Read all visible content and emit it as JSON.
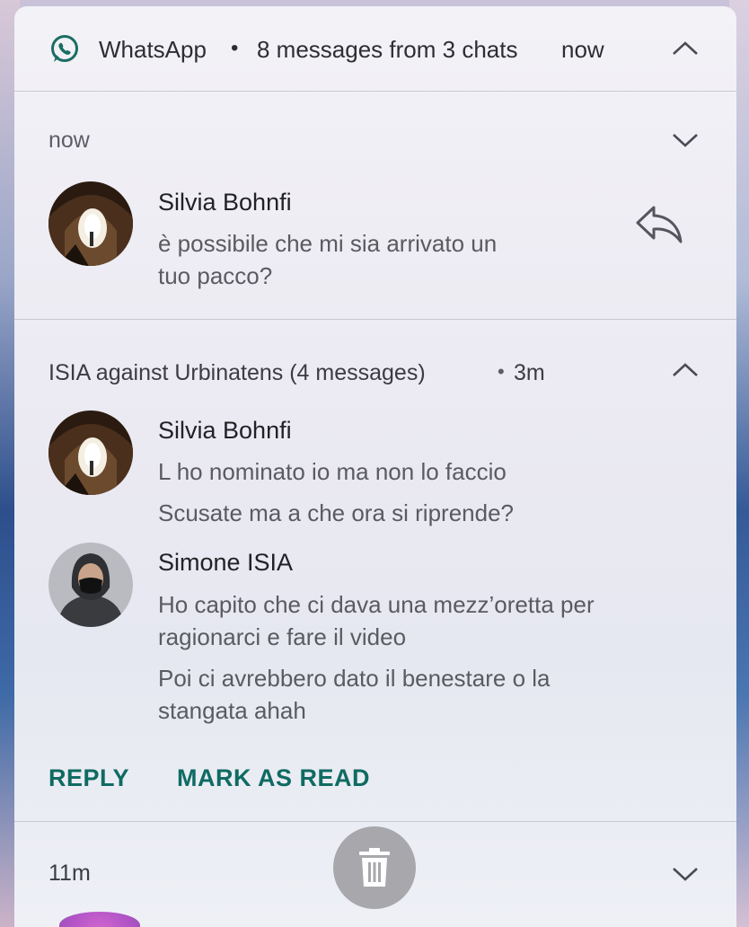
{
  "header": {
    "app_name": "WhatsApp",
    "separator": "•",
    "summary": "8 messages from 3 chats",
    "time": "now"
  },
  "notif1": {
    "time": "now",
    "sender": "Silvia Bohnfi",
    "message_line1": "è possibile che mi sia arrivato un",
    "message_line2": "tuo pacco?"
  },
  "group": {
    "title": "ISIA against Urbinatens (4 messages)",
    "separator": "•",
    "time": "3m",
    "msg1": {
      "sender": "Silvia Bohnfi",
      "line1": "L ho nominato io ma non lo faccio",
      "line2": "Scusate ma a che ora si riprende?"
    },
    "msg2": {
      "sender": "Simone ISIA",
      "line1": "Ho capito che ci dava una mezz’oretta per",
      "line2": "ragionarci e fare il video",
      "line3": "Poi ci avrebbero dato il benestare o la",
      "line4": "stangata ahah"
    }
  },
  "actions": {
    "reply": "REPLY",
    "mark_read": "MARK AS READ"
  },
  "notif3": {
    "time": "11m"
  },
  "colors": {
    "accent": "#0f6b62",
    "panel": "#eceaf2",
    "trash_button": "#a8a8ac"
  },
  "icons": [
    "whatsapp-icon",
    "chevron-up-icon",
    "chevron-down-icon",
    "reply-icon",
    "trash-icon"
  ]
}
